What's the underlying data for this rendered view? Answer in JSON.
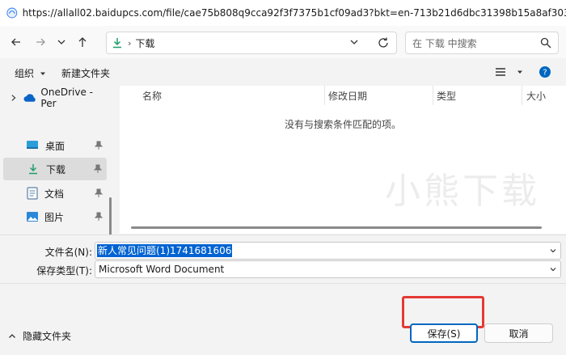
{
  "window": {
    "url": "https://allall02.baidupcs.com/file/cae75b808q9cca92f3f7375b1cf09ad3?bkt=en-713b21d6dbc31398b15a8af3036c4f5666b36c05f..."
  },
  "navigation": {
    "breadcrumb_sep": "›",
    "current_folder": "下载",
    "search_placeholder": "在 下载 中搜索"
  },
  "toolbar": {
    "organize_label": "组织",
    "new_folder_label": "新建文件夹"
  },
  "sidebar": {
    "items": [
      {
        "label": "OneDrive - Per"
      },
      {
        "label": "桌面"
      },
      {
        "label": "下载"
      },
      {
        "label": "文档"
      },
      {
        "label": "图片"
      }
    ]
  },
  "file_list": {
    "columns": [
      "名称",
      "修改日期",
      "类型",
      "大小"
    ],
    "empty_message": "没有与搜索条件匹配的项。",
    "watermark": "小熊下载"
  },
  "form": {
    "filename_label": "文件名(N):",
    "filename_value": "新人常见问题(1)1741681606",
    "filetype_label": "保存类型(T):",
    "filetype_value": "Microsoft Word Document"
  },
  "footer": {
    "hide_folders_label": "隐藏文件夹",
    "save_label": "保存(S)",
    "cancel_label": "取消"
  },
  "colors": {
    "accent": "#0067c0",
    "selection": "#0063d1",
    "highlight_frame": "#e53935",
    "download_icon": "#1e9e6a"
  }
}
